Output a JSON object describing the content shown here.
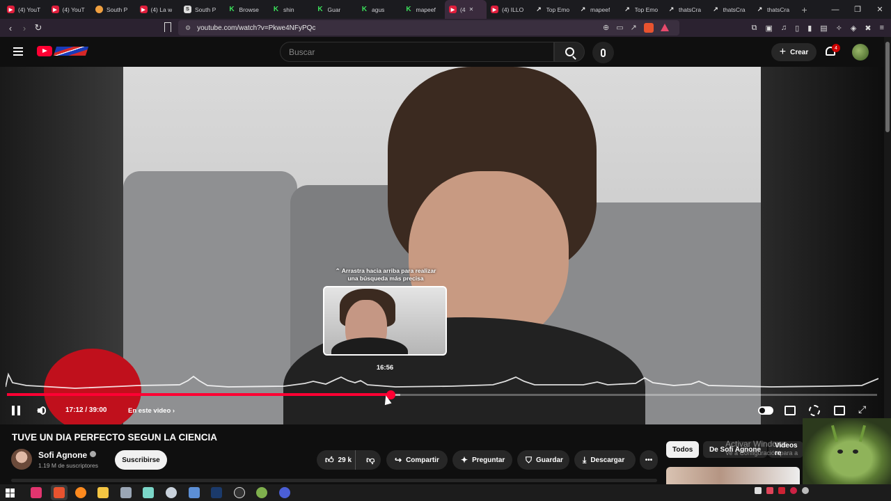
{
  "browser": {
    "tabs": [
      {
        "label": "(4) YouT",
        "favicon": "youtube-icon"
      },
      {
        "label": "(4) YouT",
        "favicon": "youtube-icon"
      },
      {
        "label": "South P",
        "favicon": "southpark-icon"
      },
      {
        "label": "(4) La w",
        "favicon": "youtube-icon"
      },
      {
        "label": "South P",
        "favicon": "s-icon"
      },
      {
        "label": "Browse",
        "favicon": "kick-icon"
      },
      {
        "label": "shin",
        "favicon": "kick-icon"
      },
      {
        "label": "Guar",
        "favicon": "kick-icon"
      },
      {
        "label": "agus",
        "favicon": "kick-icon"
      },
      {
        "label": "mapeef",
        "favicon": "kick-icon"
      },
      {
        "label": "(4",
        "favicon": "youtube-icon",
        "active": true
      },
      {
        "label": "(4) ILLO",
        "favicon": "youtube-icon"
      },
      {
        "label": "Top Emo",
        "favicon": "tracker-icon"
      },
      {
        "label": "mapeef",
        "favicon": "tracker-icon"
      },
      {
        "label": "Top Emo",
        "favicon": "tracker-icon"
      },
      {
        "label": "thatsCra",
        "favicon": "tracker-icon"
      },
      {
        "label": "thatsCra",
        "favicon": "tracker-icon"
      },
      {
        "label": "thatsCra",
        "favicon": "tracker-icon"
      }
    ],
    "url": "youtube.com/watch?v=Pkwe4NFyPQc"
  },
  "header": {
    "search_placeholder": "Buscar",
    "create_label": "Crear",
    "notification_count": "4"
  },
  "player": {
    "hint": "⌃ Arrastra hacia arriba para realizar una búsqueda más precisa",
    "preview_time": "16:56",
    "timecode": "17:12 / 39:00",
    "chapter_label": "En este video",
    "progress": 0.441,
    "buffered": 0.452
  },
  "video": {
    "title": "TUVE UN DIA PERFECTO SEGUN LA CIENCIA",
    "channel": "Sofi Agnone",
    "subscribers": "1.19 M de suscriptores",
    "subscribe_label": "Suscribirse",
    "likes": "29 k",
    "share_label": "Compartir",
    "ask_label": "Preguntar",
    "save_label": "Guardar",
    "download_label": "Descargar"
  },
  "related": {
    "chips": [
      "Todos",
      "De Sofi Agnone",
      "Videos re"
    ]
  },
  "watermark": {
    "line1": "Activar Windows",
    "line2": "Ve a Configuración para a"
  },
  "colors": {
    "accent": "#ff0033",
    "background": "#0f0f0f"
  }
}
